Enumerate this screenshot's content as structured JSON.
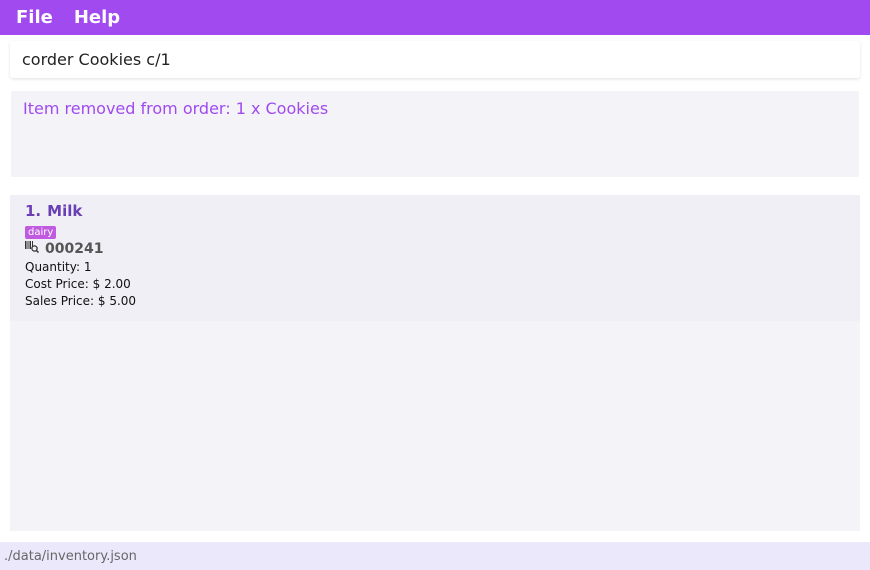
{
  "menu": {
    "file_label": "File",
    "help_label": "Help"
  },
  "command": {
    "value": "corder Cookies c/1"
  },
  "result": {
    "message": "Item removed from order: 1 x Cookies"
  },
  "items": [
    {
      "index": "1.",
      "name": "Milk",
      "tag": "dairy",
      "barcode_icon": "barcode-scan-icon",
      "barcode": "000241",
      "quantity": "Quantity: 1",
      "cost_price": "Cost Price: $ 2.00",
      "sales_price": "Sales Price: $ 5.00"
    }
  ],
  "status": {
    "path": "./data/inventory.json"
  },
  "colors": {
    "accent": "#a04af0",
    "tag": "#c05ae0",
    "item_title": "#6a3fb5"
  }
}
